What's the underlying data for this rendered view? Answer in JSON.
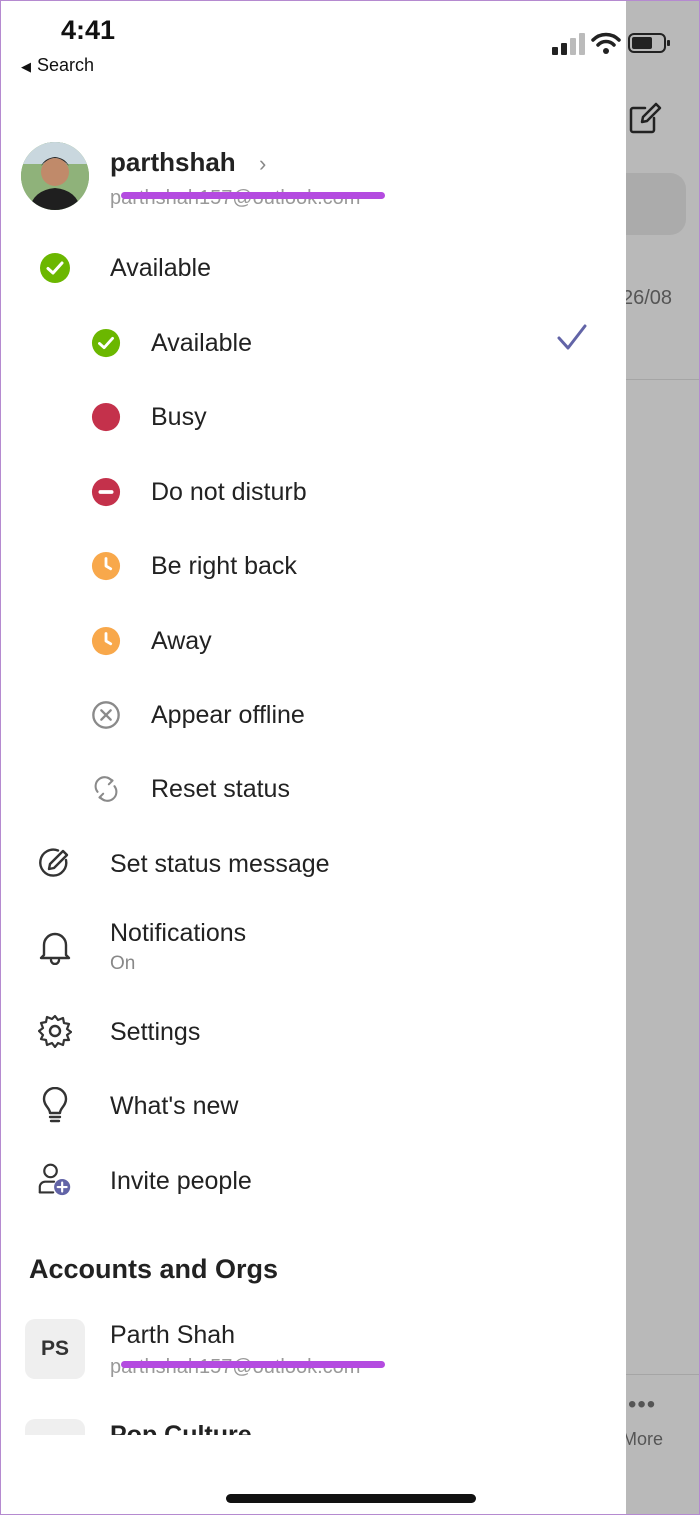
{
  "status_bar": {
    "time": "4:41",
    "back_label": "Search"
  },
  "profile": {
    "name": "parthshah",
    "email": "parthshah157@outlook.com"
  },
  "current_status": {
    "label": "Available"
  },
  "status_options": [
    {
      "label": "Available",
      "icon": "available-icon",
      "color": "#6bb700",
      "selected": true
    },
    {
      "label": "Busy",
      "icon": "busy-icon",
      "color": "#c4314b",
      "selected": false
    },
    {
      "label": "Do not disturb",
      "icon": "do-not-disturb-icon",
      "color": "#c4314b",
      "selected": false
    },
    {
      "label": "Be right back",
      "icon": "be-right-back-icon",
      "color": "#f8a84b",
      "selected": false
    },
    {
      "label": "Away",
      "icon": "away-icon",
      "color": "#f8a84b",
      "selected": false
    },
    {
      "label": "Appear offline",
      "icon": "offline-icon",
      "color": "#8a8a8a",
      "selected": false
    },
    {
      "label": "Reset status",
      "icon": "reset-icon",
      "color": "#8a8a8a",
      "selected": false
    }
  ],
  "menu": {
    "set_status_message": "Set status message",
    "notifications": {
      "label": "Notifications",
      "value": "On"
    },
    "settings": "Settings",
    "whats_new": "What's new",
    "invite_people": "Invite people"
  },
  "accounts": {
    "title": "Accounts and Orgs",
    "items": [
      {
        "initials": "PS",
        "name": "Parth Shah",
        "email": "parthshah157@outlook.com"
      },
      {
        "name": "Pop Culture"
      }
    ]
  },
  "backdrop": {
    "date_text": "26/08",
    "more_label": "More"
  },
  "colors": {
    "accent": "#6264a7",
    "redaction": "#b44be0"
  }
}
